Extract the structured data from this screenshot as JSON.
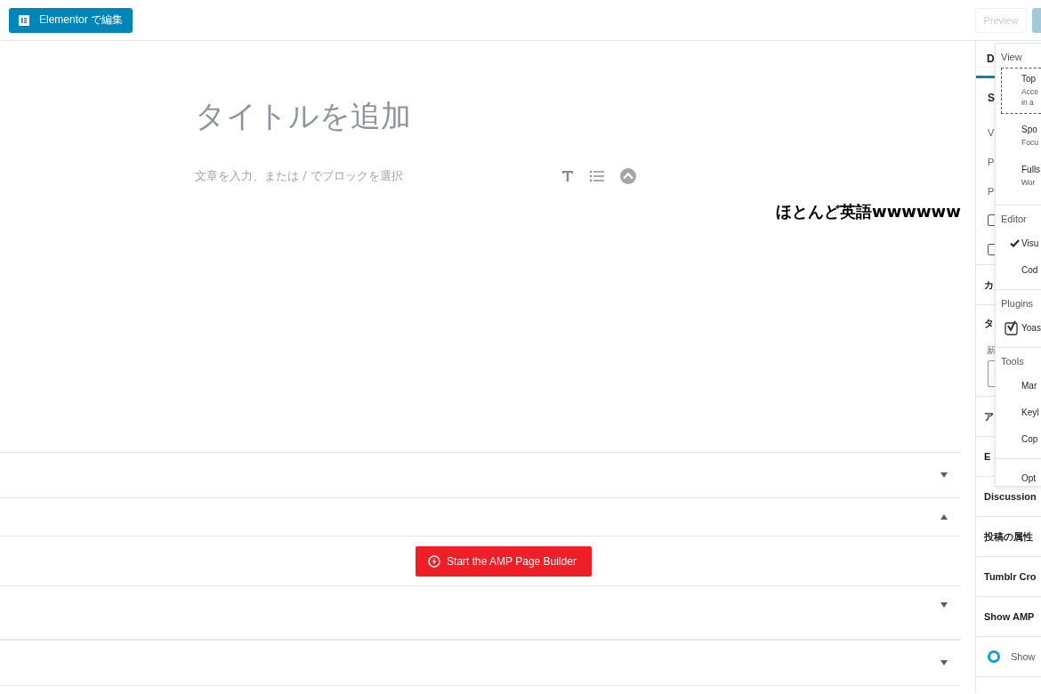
{
  "toolbar": {
    "elementor_button": {
      "label": "Elementor で編集"
    },
    "preview_button": {
      "label": "Preview",
      "disabled": true
    }
  },
  "editor": {
    "title_placeholder": "タイトルを追加",
    "paragraph_placeholder": "文章を入力、または / でブロックを選択"
  },
  "annotation": "ほとんど英語wwwwww",
  "meta_boxes": [
    {
      "expanded": false
    },
    {
      "expanded": true,
      "button": "Start the AMP Page Builder"
    },
    {
      "expanded": false
    },
    {
      "expanded": false
    }
  ],
  "sidebar": {
    "items": [
      {
        "kind": "tab",
        "label": "D",
        "selected": true
      },
      {
        "kind": "heading",
        "label": "S"
      },
      {
        "kind": "label",
        "label": "V"
      },
      {
        "kind": "label",
        "label": "P"
      },
      {
        "kind": "label",
        "label": "P"
      },
      {
        "kind": "checkbox",
        "checked": false
      },
      {
        "kind": "checkbox",
        "checked": false
      },
      {
        "kind": "panel",
        "label": "カ"
      },
      {
        "kind": "panel-open",
        "label": "タ"
      },
      {
        "kind": "small",
        "label": "新"
      },
      {
        "kind": "field"
      },
      {
        "kind": "panel",
        "label": "ア"
      },
      {
        "kind": "panel",
        "label": "E"
      },
      {
        "kind": "panel",
        "label": "Discussion"
      },
      {
        "kind": "panel",
        "label": "投稿の属性"
      },
      {
        "kind": "panel",
        "label": "Tumblr Cro"
      },
      {
        "kind": "panel",
        "label": "Show AMP"
      },
      {
        "kind": "radio",
        "label": "Show",
        "selected": true
      }
    ]
  },
  "menu": {
    "sections": [
      {
        "heading": "View",
        "items": [
          {
            "label": "Top",
            "description": [
              "Acce",
              "in a"
            ],
            "selected": true
          },
          {
            "label": "Spo",
            "description": [
              "Focu"
            ],
            "selected": false
          },
          {
            "label": "Fulls",
            "description": [
              "Wor"
            ],
            "selected": false
          }
        ]
      },
      {
        "heading": "Editor",
        "items": [
          {
            "label": "Visu",
            "checked": true
          },
          {
            "label": "Cod",
            "checked": false
          }
        ]
      },
      {
        "heading": "Plugins",
        "kind": "plugins",
        "items": [
          {
            "label": "Yoas"
          }
        ]
      },
      {
        "heading": "Tools",
        "items": [
          {
            "label": "Mar"
          },
          {
            "label": "Keyl"
          },
          {
            "label": "Cop"
          }
        ]
      },
      {
        "items": [
          {
            "label": "Opt"
          }
        ]
      }
    ]
  }
}
